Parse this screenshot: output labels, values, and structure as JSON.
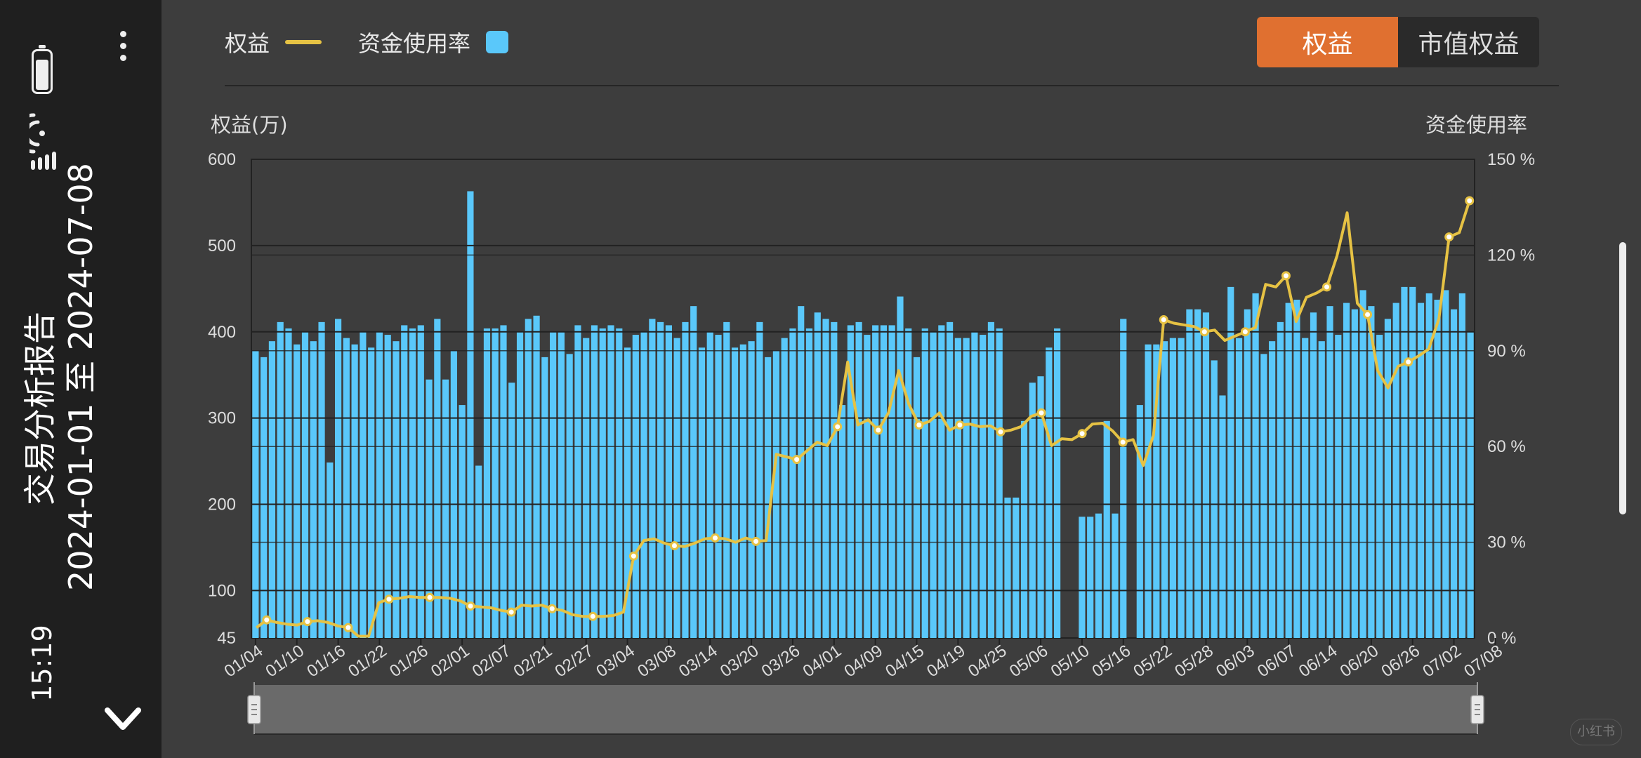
{
  "status": {
    "time": "15:19"
  },
  "report": {
    "title": "交易分析报告",
    "date_range": "2024-01-01 至 2024-07-08"
  },
  "legend": {
    "equity_label": "权益",
    "usage_label": "资金使用率"
  },
  "toggle": {
    "equity": "权益",
    "market_value_equity": "市值权益",
    "active": "权益"
  },
  "watermark": "小红书",
  "colors": {
    "bars": "#5ac8fa",
    "line": "#e6c244",
    "active_tab": "#e07030",
    "background": "#3d3d3d"
  },
  "chart_data": {
    "type": "bar",
    "xlabel": "",
    "ylabel_left": "权益(万)",
    "ylabel_right": "资金使用率",
    "ylim_left": [
      45,
      600
    ],
    "ylim_right": [
      0,
      150
    ],
    "left_ticks": [
      45,
      100,
      200,
      300,
      400,
      500,
      600
    ],
    "right_ticks": [
      "0 %",
      "30 %",
      "60 %",
      "90 %",
      "120 %",
      "150 %"
    ],
    "right_tick_values": [
      0,
      30,
      60,
      90,
      120,
      150
    ],
    "x_tick_labels": [
      "01/04",
      "01/10",
      "01/16",
      "01/22",
      "01/26",
      "02/01",
      "02/07",
      "02/21",
      "02/27",
      "03/04",
      "03/08",
      "03/14",
      "03/20",
      "03/26",
      "04/01",
      "04/09",
      "04/15",
      "04/19",
      "04/25",
      "05/06",
      "05/10",
      "05/16",
      "05/22",
      "05/28",
      "06/03",
      "06/07",
      "06/14",
      "06/20",
      "06/26",
      "07/02",
      "07/08"
    ],
    "x_tick_positions": [
      0,
      5,
      10,
      15,
      20,
      25,
      30,
      35,
      40,
      45,
      50,
      55,
      60,
      65,
      70,
      75,
      80,
      85,
      90,
      95,
      100,
      105,
      110,
      115,
      120,
      125,
      130,
      135,
      140,
      145,
      150
    ],
    "series": [
      {
        "name": "资金使用率",
        "type": "bar",
        "axis": "right",
        "values": [
          90,
          88,
          93,
          99,
          97,
          92,
          96,
          93,
          99,
          55,
          100,
          94,
          92,
          96,
          91,
          96,
          95,
          93,
          98,
          97,
          98,
          81,
          100,
          81,
          90,
          73,
          140,
          54,
          97,
          97,
          98,
          80,
          96,
          100,
          101,
          88,
          96,
          96,
          89,
          98,
          94,
          98,
          97,
          98,
          97,
          91,
          95,
          96,
          100,
          99,
          98,
          94,
          99,
          104,
          91,
          96,
          95,
          99,
          91,
          92,
          93,
          99,
          88,
          90,
          94,
          97,
          104,
          97,
          102,
          100,
          99,
          73,
          98,
          99,
          95,
          98,
          98,
          98,
          107,
          97,
          88,
          97,
          96,
          98,
          99,
          94,
          94,
          96,
          95,
          99,
          97,
          44,
          44,
          68,
          80,
          82,
          91,
          97,
          0,
          0,
          38,
          38,
          39,
          68,
          39,
          100,
          0,
          73,
          92,
          92,
          93,
          94,
          94,
          103,
          103,
          102,
          87,
          76,
          110,
          94,
          103,
          108,
          89,
          93,
          99,
          105,
          106,
          94,
          102,
          93,
          104,
          95,
          105,
          103,
          109,
          104,
          95,
          100,
          105,
          110,
          110,
          105,
          108,
          106,
          109,
          103,
          108,
          96
        ]
      },
      {
        "name": "权益",
        "type": "line",
        "axis": "left",
        "values": [
          57,
          66,
          63,
          61,
          60,
          64,
          65,
          63,
          59,
          57,
          47,
          47,
          86,
          90,
          91,
          93,
          92,
          92,
          92,
          91,
          88,
          82,
          81,
          80,
          77,
          75,
          83,
          82,
          83,
          79,
          77,
          72,
          70,
          70,
          70,
          71,
          75,
          140,
          158,
          160,
          155,
          152,
          151,
          155,
          160,
          161,
          160,
          156,
          161,
          157,
          158,
          258,
          255,
          252,
          262,
          272,
          268,
          290,
          365,
          292,
          298,
          286,
          306,
          355,
          316,
          292,
          296,
          306,
          286,
          292,
          293,
          290,
          291,
          284,
          286,
          290,
          302,
          306,
          268,
          276,
          275,
          282,
          293,
          294,
          285,
          272,
          275,
          245,
          280,
          414,
          410,
          408,
          406,
          400,
          402,
          390,
          395,
          400,
          405,
          455,
          452,
          465,
          412,
          440,
          445,
          452,
          488,
          538,
          433,
          420,
          355,
          335,
          360,
          365,
          372,
          380,
          415,
          510,
          515,
          552
        ]
      }
    ]
  }
}
